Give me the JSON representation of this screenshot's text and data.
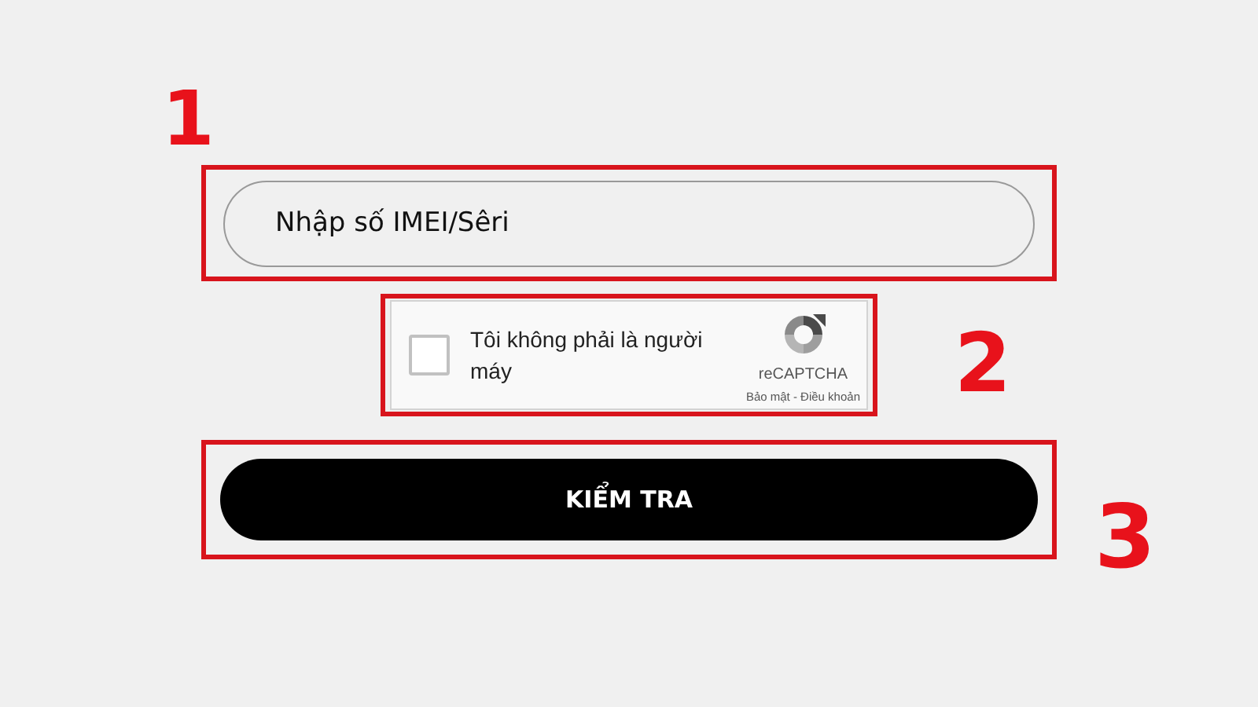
{
  "imei_field": {
    "placeholder": "Nhập số IMEI/Sêri",
    "callout": "1"
  },
  "captcha": {
    "label": "Tôi không phải là người máy",
    "checked": false,
    "brand": "reCAPTCHA",
    "links": "Bảo mật - Điều khoản",
    "callout": "2"
  },
  "check_button": {
    "label": "KIỂM TRA",
    "callout": "3"
  }
}
